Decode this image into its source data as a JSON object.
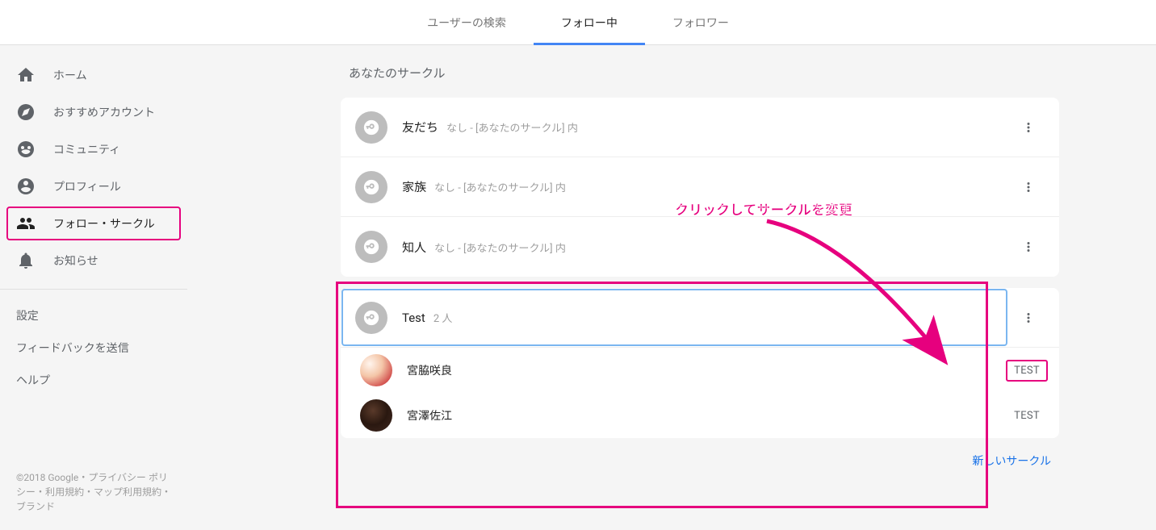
{
  "tabs": {
    "search": "ユーザーの検索",
    "following": "フォロー中",
    "followers": "フォロワー"
  },
  "sidebar": {
    "items": [
      {
        "label": "ホーム"
      },
      {
        "label": "おすすめアカウント"
      },
      {
        "label": "コミュニティ"
      },
      {
        "label": "プロフィール"
      },
      {
        "label": "フォロー・サークル"
      },
      {
        "label": "お知らせ"
      }
    ],
    "secondary": {
      "settings": "設定",
      "feedback": "フィードバックを送信",
      "help": "ヘルプ"
    },
    "footer": "©2018 Google・プライバシー ポリシー・利用規約・マップ利用規約・ブランド"
  },
  "main": {
    "section_title": "あなたのサークル",
    "circles": [
      {
        "name": "友だち",
        "sub": "なし - [あなたのサークル] 内"
      },
      {
        "name": "家族",
        "sub": "なし - [あなたのサークル] 内"
      },
      {
        "name": "知人",
        "sub": "なし - [あなたのサークル] 内"
      }
    ],
    "expanded": {
      "name": "Test",
      "count": "2 人",
      "members": [
        {
          "name": "宮脇咲良",
          "chip": "TEST"
        },
        {
          "name": "宮澤佐江",
          "chip": "TEST"
        }
      ]
    },
    "create_new": "新しいサークル"
  },
  "annotation": {
    "text": "クリックしてサークルを変更"
  }
}
